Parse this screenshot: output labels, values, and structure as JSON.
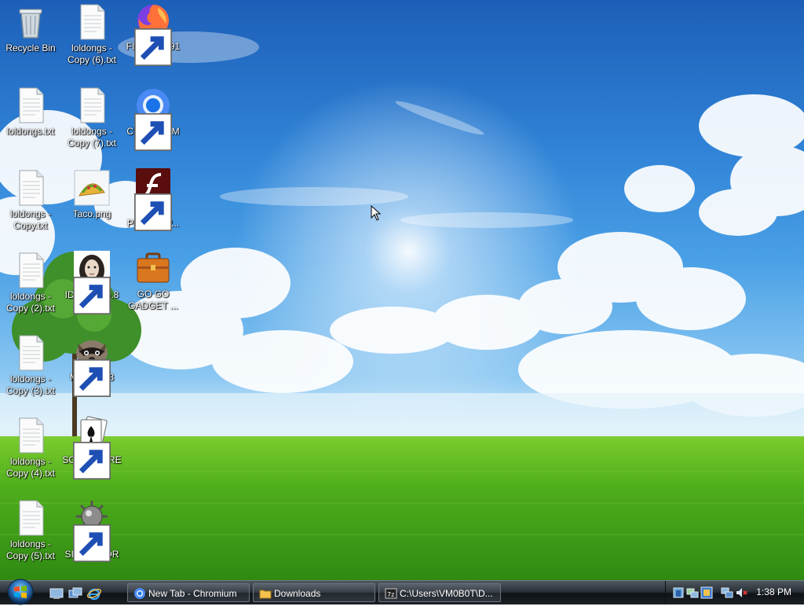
{
  "desktop_icons": [
    {
      "label": "Recycle Bin",
      "icon": "recycle-bin-icon"
    },
    {
      "label": "loldongs - Copy (6).txt",
      "icon": "text-file-icon"
    },
    {
      "label": "FIREFOX 91",
      "icon": "firefox-icon",
      "shortcut": true
    },
    {
      "label": "loldongs.txt",
      "icon": "text-file-icon"
    },
    {
      "label": "loldongs - Copy (7).txt",
      "icon": "text-file-icon"
    },
    {
      "label": "CHROMIUM 101",
      "icon": "chromium-icon",
      "shortcut": true
    },
    {
      "label": "loldongs - Copy.txt",
      "icon": "text-file-icon"
    },
    {
      "label": "Taco.png",
      "icon": "taco-image-icon"
    },
    {
      "label": "FLASH PLAYER P...",
      "icon": "flash-player-icon",
      "shortcut": true
    },
    {
      "label": "loldongs - Copy (2).txt",
      "icon": "text-file-icon"
    },
    {
      "label": "IDA PRO 6.8",
      "icon": "ida-pro-icon",
      "shortcut": true
    },
    {
      "label": "GO GO GADGET ...",
      "icon": "briefcase-icon"
    },
    {
      "label": "loldongs - Copy (3).txt",
      "icon": "text-file-icon"
    },
    {
      "label": "MYPAL 68",
      "icon": "mypal-raccoon-icon",
      "shortcut": true
    },
    {
      "label": "loldongs - Copy (4).txt",
      "icon": "text-file-icon"
    },
    {
      "label": "SO LIT!! AIRE",
      "icon": "solitaire-cards-icon",
      "shortcut": true
    },
    {
      "label": "loldongs - Copy (5).txt",
      "icon": "text-file-icon"
    },
    {
      "label": "BOSNIA SIMULATOR",
      "icon": "mine-icon",
      "shortcut": true
    }
  ],
  "taskbar": {
    "start_icon": "windows-start-orb-icon",
    "quick_launch": [
      "show-desktop-icon",
      "switch-windows-icon",
      "internet-explorer-icon"
    ],
    "tasks": [
      {
        "label": "New Tab - Chromium",
        "icon": "chromium-icon"
      },
      {
        "label": "Downloads",
        "icon": "folder-icon"
      },
      {
        "label": "C:\\Users\\VM0B0T\\D...",
        "icon": "7zip-icon"
      }
    ],
    "tray": {
      "icons": [
        "tray-app-icon",
        "tray-network-share-icon",
        "tray-update-icon",
        "network-icon",
        "volume-muted-icon"
      ],
      "clock": "1:38 PM"
    }
  },
  "colors": {
    "sky_top": "#1d5fb8",
    "grass": "#4caf1e",
    "taskbar": "#1b2026"
  }
}
